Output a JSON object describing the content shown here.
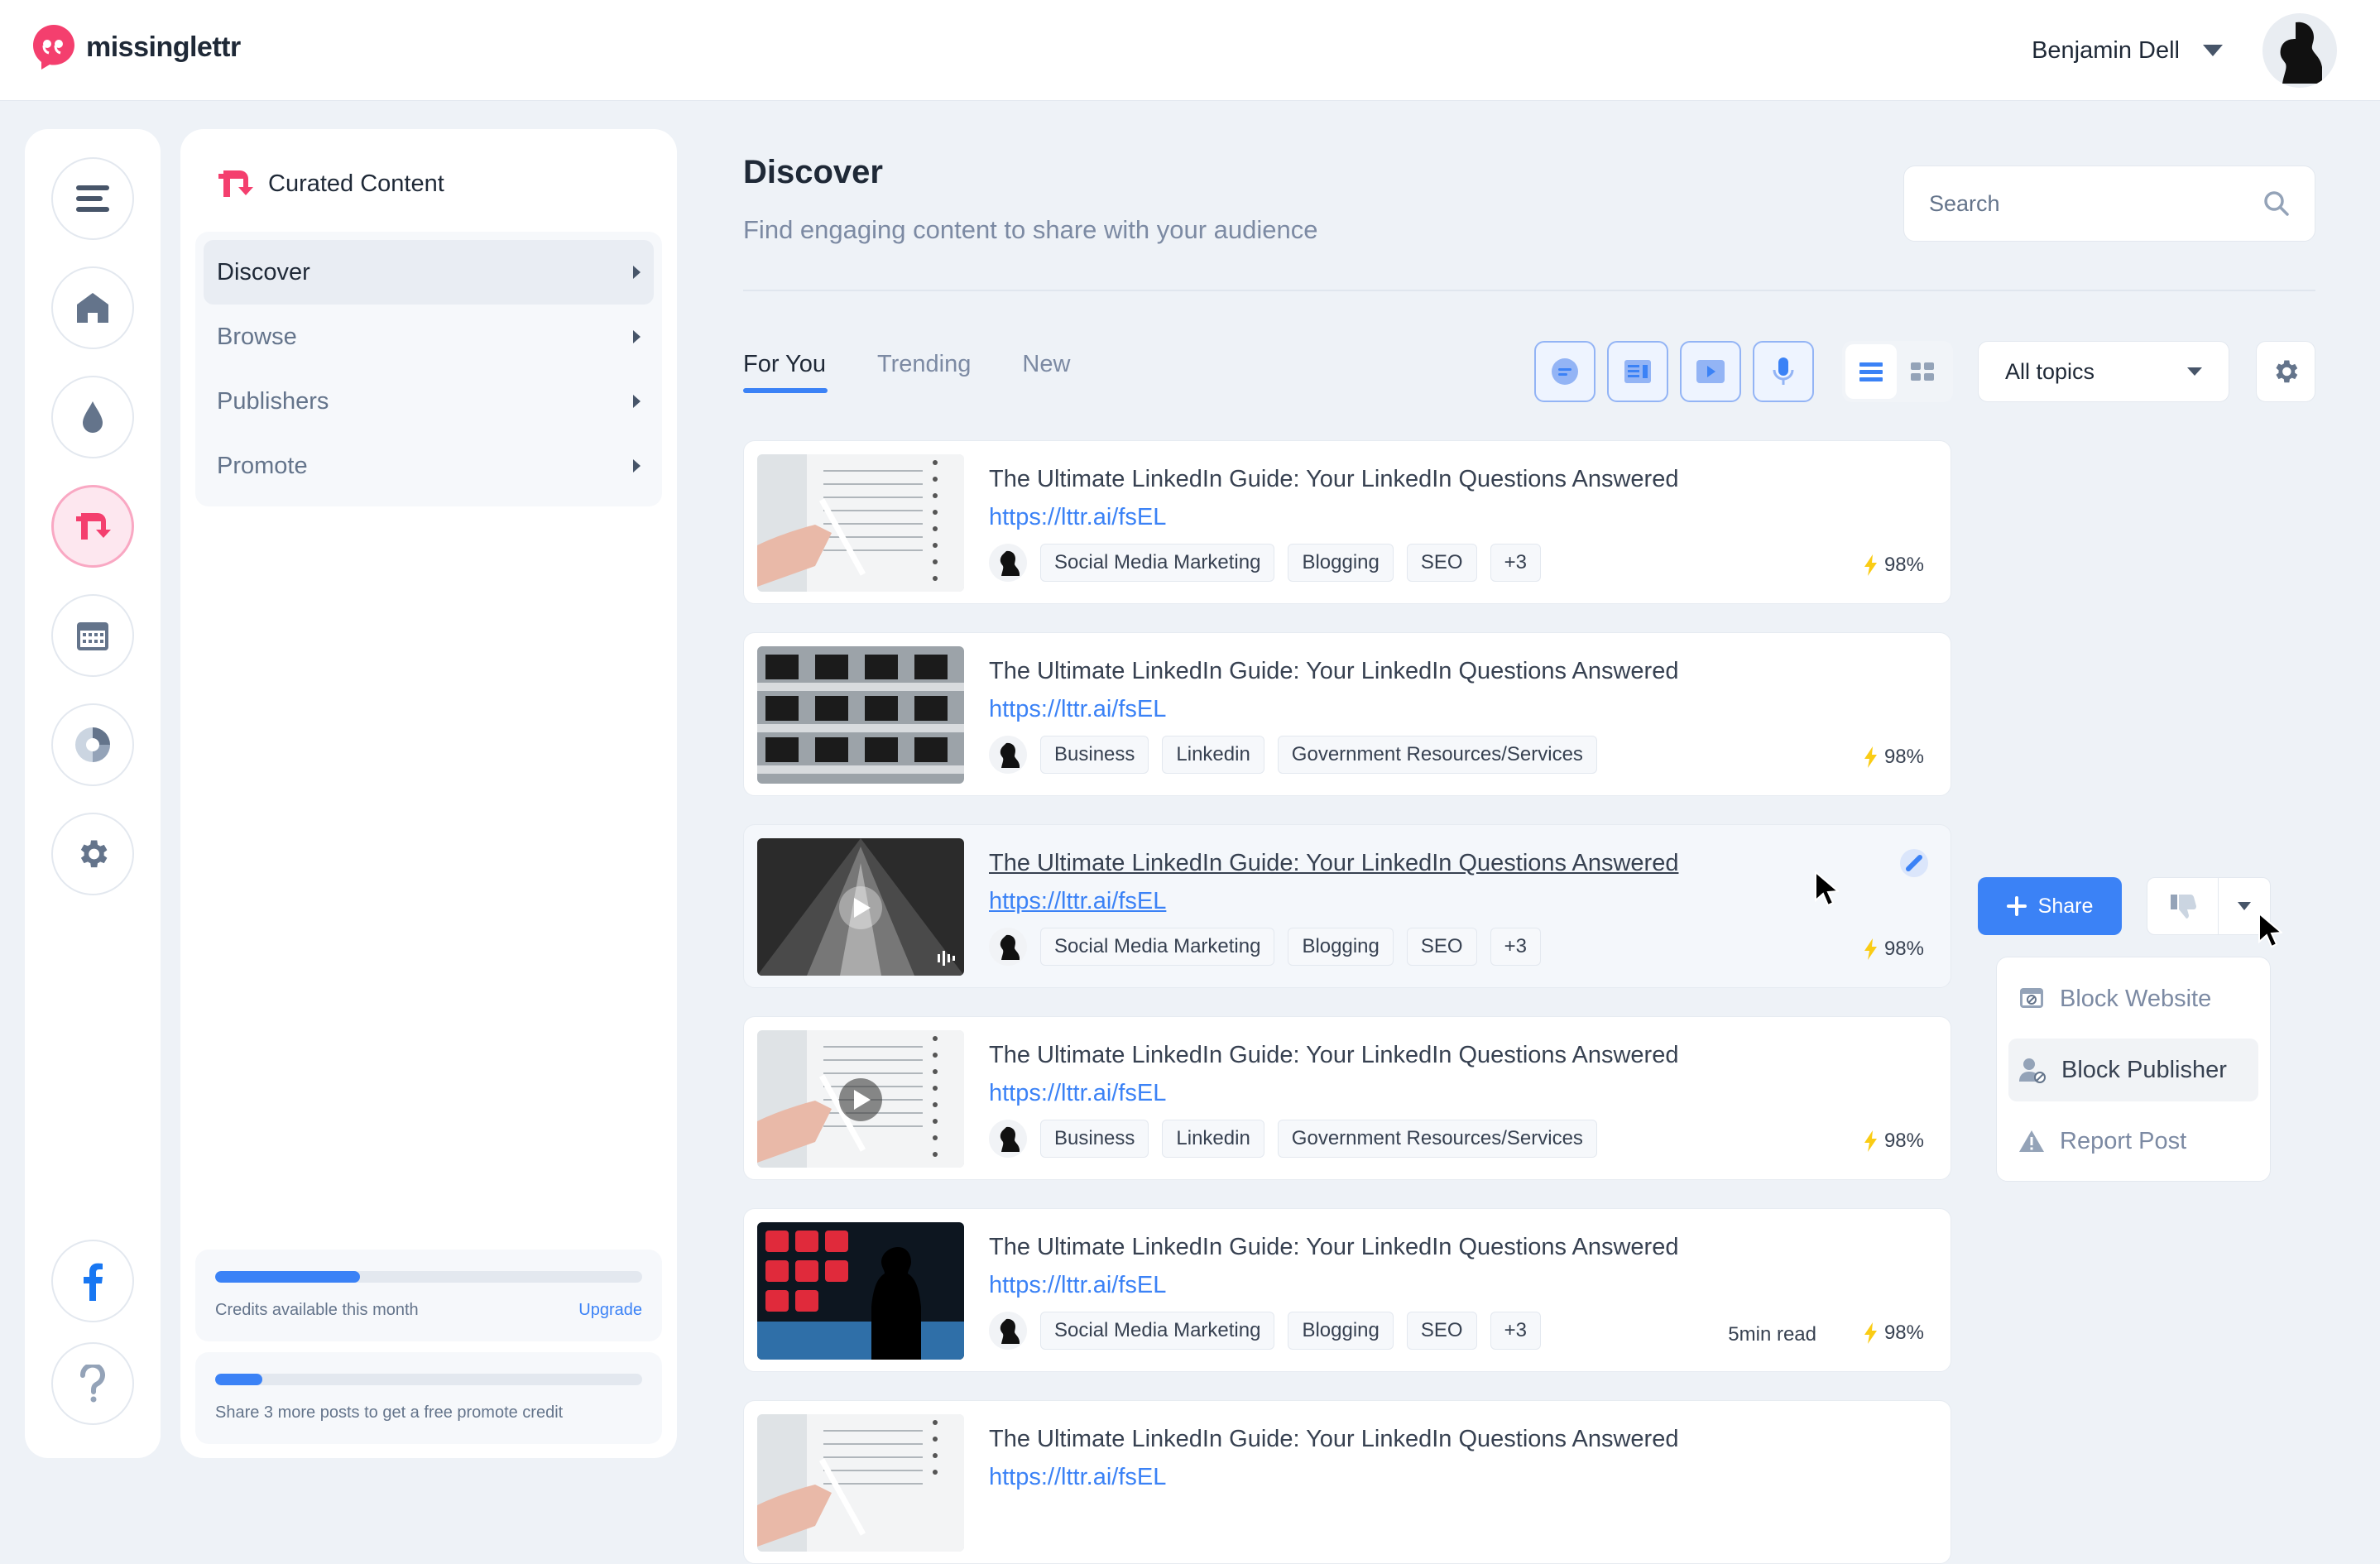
{
  "app": {
    "brand": "missinglettr",
    "brand_color": "#f43f6e",
    "accent": "#3b82f6"
  },
  "user": {
    "name": "Benjamin Dell"
  },
  "rail": {
    "icons": [
      "menu-icon",
      "home-icon",
      "drop-icon",
      "curate-icon",
      "calendar-icon",
      "analytics-icon",
      "gear-icon",
      "facebook-icon",
      "help-icon"
    ]
  },
  "subnav": {
    "title": "Curated Content",
    "items": [
      {
        "label": "Discover"
      },
      {
        "label": "Browse"
      },
      {
        "label": "Publishers"
      },
      {
        "label": "Promote"
      }
    ],
    "credits": {
      "progress": 0.34,
      "label": "Credits available this month",
      "upgrade": "Upgrade"
    },
    "promote": {
      "progress": 0.11,
      "label": "Share 3 more posts to get a free promote credit"
    }
  },
  "page": {
    "title": "Discover",
    "subtitle": "Find engaging content to share with your audience"
  },
  "search": {
    "placeholder": "Search"
  },
  "tabs": [
    {
      "label": "For You"
    },
    {
      "label": "Trending"
    },
    {
      "label": "New"
    }
  ],
  "topics": {
    "selected": "All topics"
  },
  "cards": [
    {
      "title": "The Ultimate LinkedIn Guide: Your LinkedIn Questions Answered",
      "url": "https://lttr.ai/fsEL",
      "tags": [
        "Social Media Marketing",
        "Blogging",
        "SEO",
        "+3"
      ],
      "score": "98%",
      "read": ""
    },
    {
      "title": "The Ultimate LinkedIn Guide: Your LinkedIn Questions Answered",
      "url": "https://lttr.ai/fsEL",
      "tags": [
        "Business",
        "Linkedin",
        "Government Resources/Services"
      ],
      "score": "98%",
      "read": ""
    },
    {
      "title": "The Ultimate LinkedIn Guide: Your LinkedIn Questions Answered",
      "url": "https://lttr.ai/fsEL",
      "tags": [
        "Social Media Marketing",
        "Blogging",
        "SEO",
        "+3"
      ],
      "score": "98%",
      "read": ""
    },
    {
      "title": "The Ultimate LinkedIn Guide: Your LinkedIn Questions Answered",
      "url": "https://lttr.ai/fsEL",
      "tags": [
        "Business",
        "Linkedin",
        "Government Resources/Services"
      ],
      "score": "98%",
      "read": ""
    },
    {
      "title": "The Ultimate LinkedIn Guide: Your LinkedIn Questions Answered",
      "url": "https://lttr.ai/fsEL",
      "tags": [
        "Social Media Marketing",
        "Blogging",
        "SEO",
        "+3"
      ],
      "score": "98%",
      "read": "5min read"
    },
    {
      "title": "The Ultimate LinkedIn Guide: Your LinkedIn Questions Answered",
      "url": "https://lttr.ai/fsEL",
      "tags": [],
      "score": "",
      "read": ""
    }
  ],
  "actions": {
    "share": "Share"
  },
  "menu": {
    "items": [
      "Block Website",
      "Block Publisher",
      "Report Post"
    ]
  }
}
